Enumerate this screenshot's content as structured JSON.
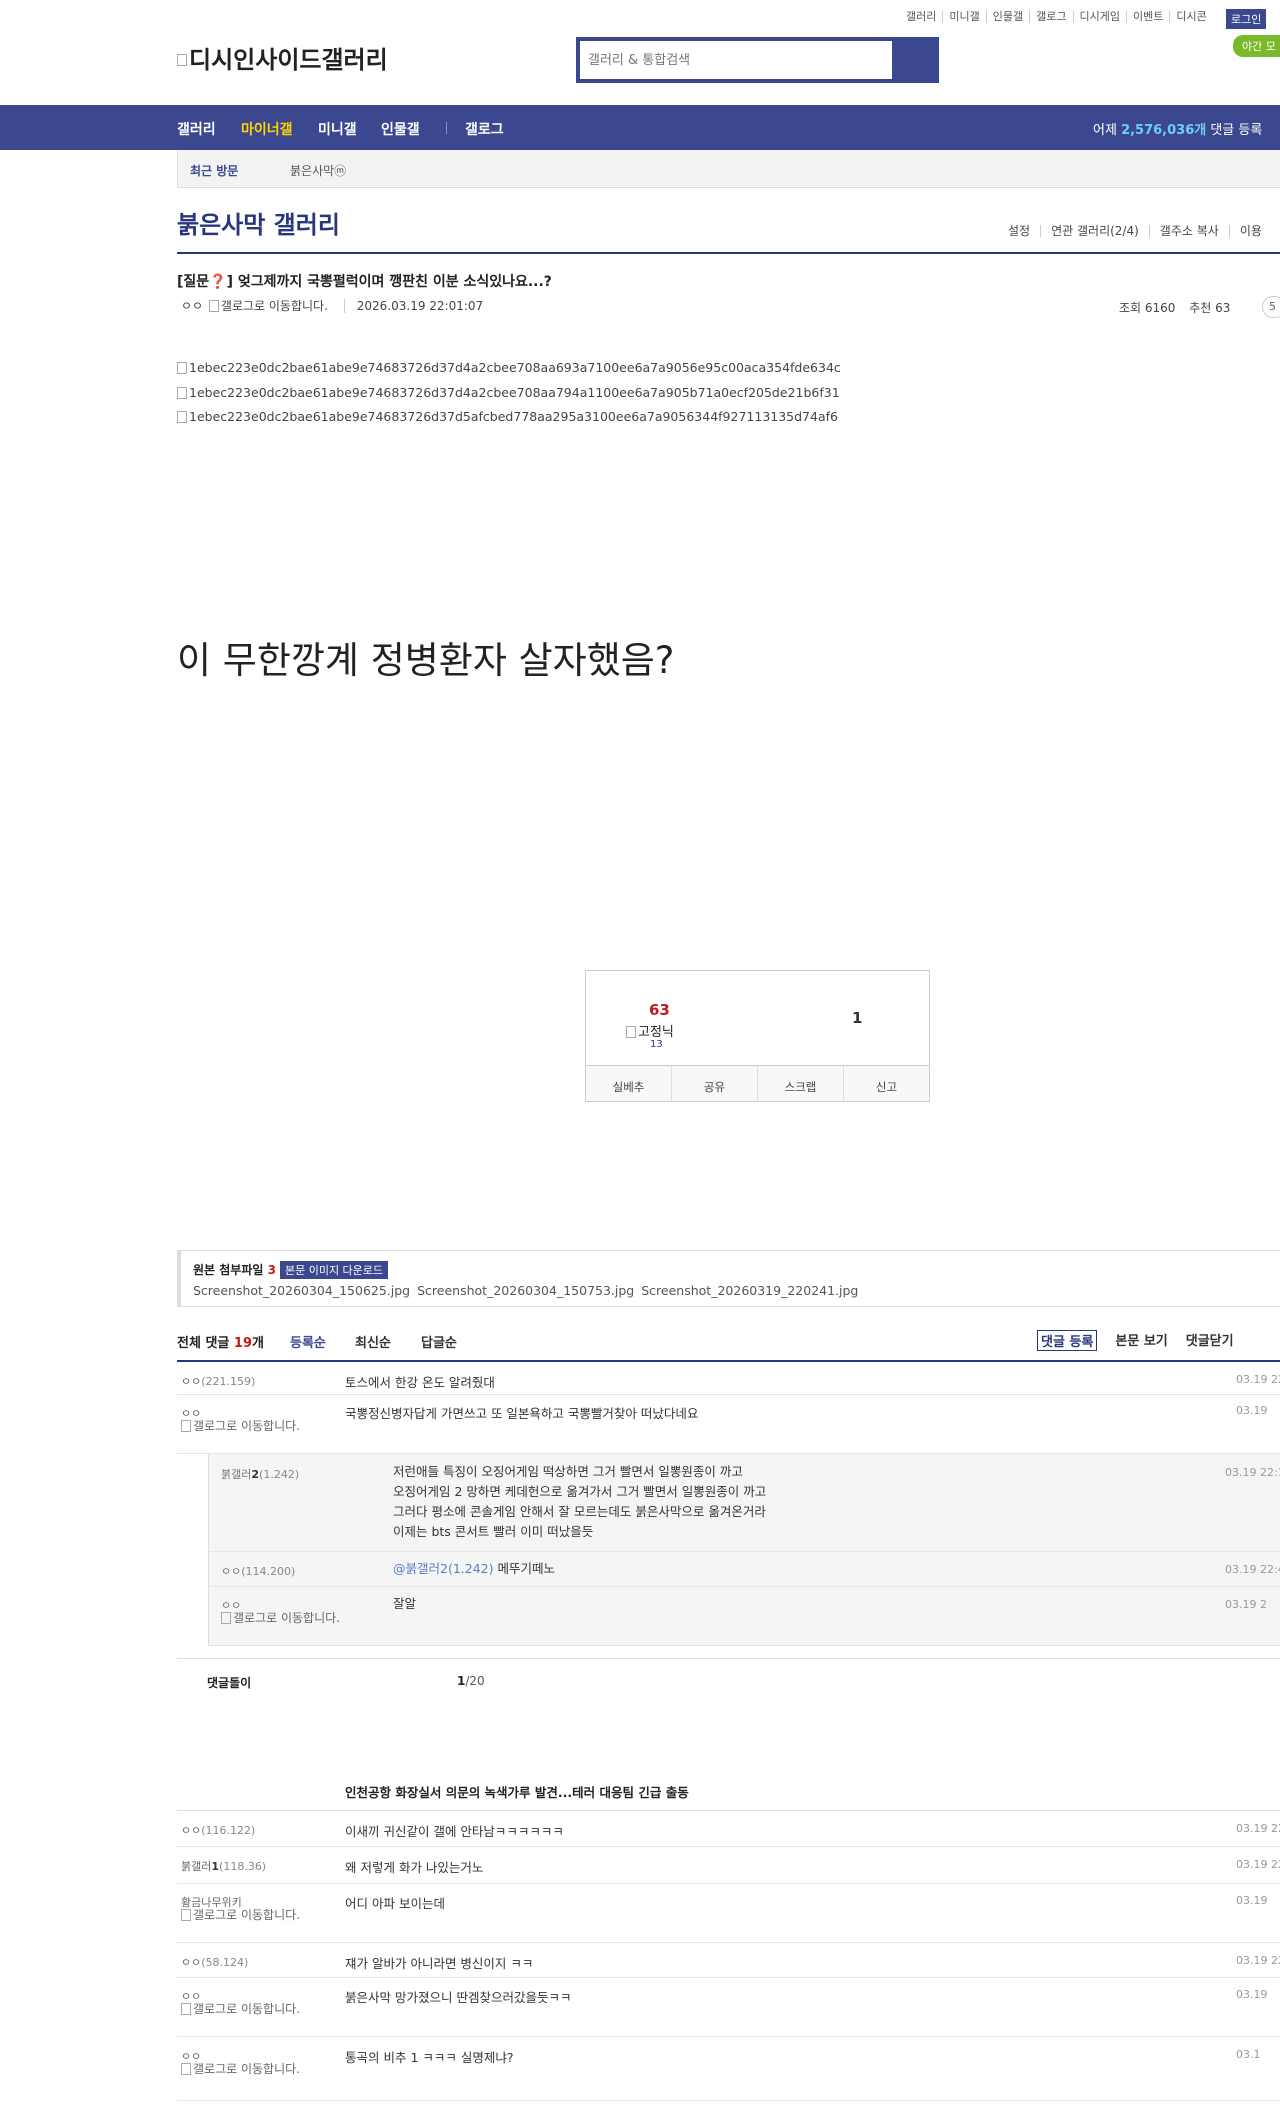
{
  "top_links": [
    "갤러리",
    "미니갤",
    "인물갤",
    "갤로그",
    "디시게임",
    "이벤트",
    "디시콘"
  ],
  "login_label": "로그인",
  "night_mode_label": "야간 모",
  "logo_alt": "디시인사이드갤러리",
  "search": {
    "placeholder": "갤러리 & 통합검색"
  },
  "gnb": {
    "items": [
      "갤러리",
      "마이너갤",
      "미니갤",
      "인물갤",
      "갤로그"
    ],
    "yesterday_prefix": "어제 ",
    "yesterday_count": "2,576,036개",
    "yesterday_suffix": " 댓글 등록"
  },
  "recent": {
    "title": "최근 방문",
    "gallery": "붉은사막ⓜ"
  },
  "gallery_title": "붉은사막 갤러리",
  "gallery_options": [
    "설정",
    "연관 갤러리(2/4)",
    "갤주소 복사",
    "이용"
  ],
  "post": {
    "title_prefix": "[질문",
    "title_mark": "❓",
    "title_rest": "] 엊그제까지 국뽕펄럭이며 깽판친 이분 소식있나요...?",
    "author": "ㅇㅇ",
    "gallog_alt": "갤로그로 이동합니다.",
    "date": "2026.03.19 22:01:07",
    "views": "조회 6160",
    "recommend": "추천 63",
    "badge": "5"
  },
  "images": [
    "1ebec223e0dc2bae61abe9e74683726d37d4a2cbee708aa693a7100ee6a7a9056e95c00aca354fde634c",
    "1ebec223e0dc2bae61abe9e74683726d37d4a2cbee708aa794a1100ee6a7a905b71a0ecf205de21b6f31",
    "1ebec223e0dc2bae61abe9e74683726d37d5afcbed778aa295a3100ee6a7a9056344f927113135d74af6"
  ],
  "body_text": "이  무한깡계 정병환자 살자했음?",
  "recommend_box": {
    "up": "63",
    "fixed_alt": "고정닉",
    "fixed_count": "13",
    "down": "1",
    "buttons": [
      "실베추",
      "공유",
      "스크랩",
      "신고"
    ]
  },
  "attachments": {
    "title": "원본 첨부파일",
    "count": "3",
    "download": "본문 이미지 다운로드",
    "files": [
      "Screenshot_20260304_150625.jpg",
      "Screenshot_20260304_150753.jpg",
      "Screenshot_20260319_220241.jpg"
    ]
  },
  "comments_bar": {
    "total_label": "전체 댓글",
    "total_count": "19",
    "total_unit": "개",
    "sorts": [
      "등록순",
      "최신순",
      "답글순"
    ],
    "actions": [
      "댓글 등록",
      "본문 보기",
      "댓글닫기"
    ]
  },
  "comments": [
    {
      "nick": "ㅇㅇ",
      "ip": "(221.159)",
      "text": "토스에서 한강 온도 알려줬대",
      "date": "03.19 22"
    },
    {
      "nick": "ㅇㅇ",
      "gallog": "갤로그로 이동합니다.",
      "text": "국뽕정신병자답게 가면쓰고 또 일본욕하고 국뽕빨거찾아 떠났다네요",
      "date": "03.19"
    }
  ],
  "replies": [
    {
      "nick": "붉갤러",
      "nick_bold": "2",
      "nick_ip": "(1.242)",
      "lines": [
        "저런애들 특징이 오징어게임 떡상하면 그거 빨면서 일뽕원종이 까고",
        "오징어게임 2 망하면 케데헌으로 옮겨가서 그거 빨면서 일뽕원종이 까고",
        "그러다 평소에 콘솔게임 안해서 잘 모르는데도 붉은사막으로 옮겨온거라",
        "이제는 bts 콘서트 빨러 이미 떠났을듯"
      ],
      "date": "03.19 22:1"
    },
    {
      "nick": "ㅇㅇ",
      "nick_ip": "(114.200)",
      "mention": "@붉갤러2(1.242)",
      "text": " 메뚜기떼노",
      "date": "03.19 22:4"
    },
    {
      "nick": "ㅇㅇ",
      "gallog": "갤로그로 이동합니다.",
      "text": "잘알",
      "date": "03.19 2"
    }
  ],
  "turn": {
    "label": "댓글돌이",
    "page": "1",
    "total": "/20"
  },
  "news_headline": "인천공항 화장실서 의문의 녹색가루 발견...테러 대응팀 긴급 출동",
  "bottom_comments": [
    {
      "nick": "ㅇㅇ",
      "ip": "(116.122)",
      "text": "이새끼 귀신같이 갤에 안타남ㅋㅋㅋㅋㅋㅋ",
      "date": "03.19 22"
    },
    {
      "nick": "붉갤러",
      "nick_bold": "1",
      "ip": "(118.36)",
      "text": "왜 저렇게 화가 나있는거노",
      "date": "03.19 22"
    },
    {
      "nick": "황금나무위키",
      "gallog": "갤로그로 이동합니다.",
      "text": "어디 아파 보이는데",
      "date": "03.19"
    },
    {
      "nick": "ㅇㅇ",
      "ip": "(58.124)",
      "text": "쟤가 알바가 아니라면 병신이지 ㅋㅋ",
      "date": "03.19 22"
    },
    {
      "nick": "ㅇㅇ",
      "gallog": "갤로그로 이동합니다.",
      "text": "붉은사막 망가졌으니 딴겜찾으러갔을듯ㅋㅋ",
      "date": "03.19"
    },
    {
      "nick": "ㅇㅇ",
      "gallog": "갤로그로 이동합니다.",
      "text": "통곡의 비추 1 ㅋㅋㅋ 실명제냐?",
      "date": "03.1"
    }
  ]
}
